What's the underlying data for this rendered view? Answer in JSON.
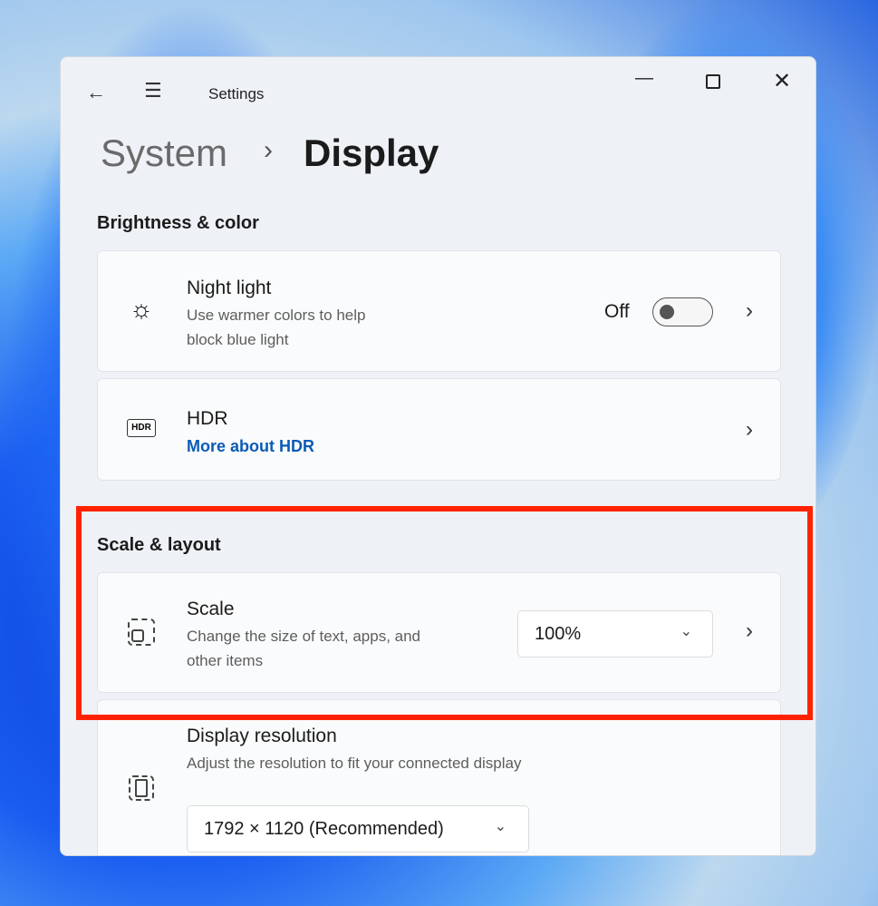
{
  "window": {
    "title": "Settings",
    "back_icon": "arrow-left-icon",
    "menu_icon": "hamburger-icon"
  },
  "breadcrumb": {
    "parent": "System",
    "separator": "›",
    "current": "Display"
  },
  "sections": {
    "brightness": {
      "heading": "Brightness & color",
      "night_light": {
        "title": "Night light",
        "description_line1": "Use warmer colors to help",
        "description_line2": "block blue light",
        "state_label": "Off",
        "toggle_on": false
      },
      "hdr": {
        "title": "HDR",
        "link": "More about HDR"
      }
    },
    "scale": {
      "heading": "Scale & layout",
      "scale": {
        "title": "Scale",
        "description_line1": "Change the size of text, apps, and",
        "description_line2": "other items",
        "value": "100%"
      },
      "resolution": {
        "title": "Display resolution",
        "description": "Adjust the resolution to fit your connected display",
        "value": "1792 × 1120 (Recommended)"
      }
    }
  },
  "highlight_color": "#ff2200"
}
